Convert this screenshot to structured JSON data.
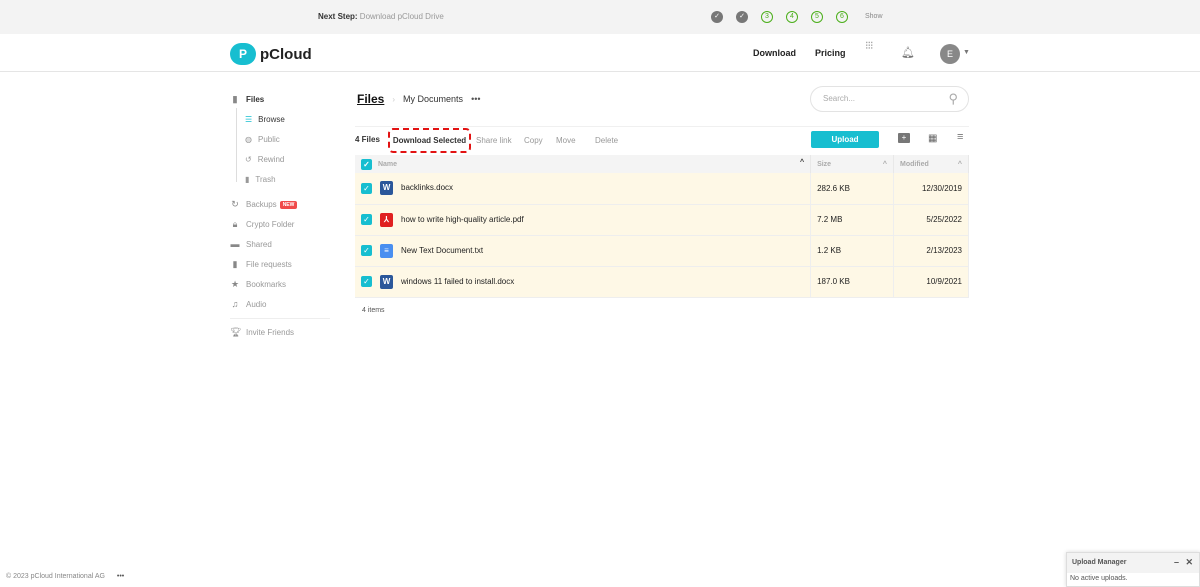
{
  "banner": {
    "next_step_label": "Next Step:",
    "next_step_text": "Download pCloud Drive",
    "steps": [
      "✓",
      "✓",
      "3",
      "4",
      "5",
      "6"
    ],
    "show": "Show"
  },
  "header": {
    "logo": "pCloud",
    "download": "Download",
    "pricing": "Pricing",
    "avatar": "E"
  },
  "sidebar": {
    "files": "Files",
    "sub": [
      "Browse",
      "Public",
      "Rewind",
      "Trash"
    ],
    "items": [
      "Backups",
      "Crypto Folder",
      "Shared",
      "File requests",
      "Bookmarks",
      "Audio"
    ],
    "new_badge": "NEW",
    "invite": "Invite Friends"
  },
  "breadcrumb": {
    "root": "Files",
    "current": "My Documents",
    "more": "•••"
  },
  "search": {
    "placeholder": "Search..."
  },
  "toolbar": {
    "count": "4 Files",
    "download_selected": "Download Selected",
    "share_link": "Share link",
    "copy": "Copy",
    "move": "Move",
    "delete": "Delete",
    "upload": "Upload"
  },
  "table": {
    "headers": [
      "Name",
      "Size",
      "Modified"
    ],
    "rows": [
      {
        "name": "backlinks.docx",
        "type": "word",
        "size": "282.6 KB",
        "modified": "12/30/2019"
      },
      {
        "name": "how to write high-quality article.pdf",
        "type": "pdf",
        "size": "7.2 MB",
        "modified": "5/25/2022"
      },
      {
        "name": "New Text Document.txt",
        "type": "text",
        "size": "1.2 KB",
        "modified": "2/13/2023"
      },
      {
        "name": "windows 11 failed to install.docx",
        "type": "word",
        "size": "187.0 KB",
        "modified": "10/9/2021"
      }
    ]
  },
  "item_count": "4 items",
  "footer": {
    "copyright": "© 2023 pCloud International AG",
    "more": "•••"
  },
  "upload_manager": {
    "title": "Upload Manager",
    "status": "No active uploads."
  },
  "colors": {
    "accent": "#17bed0",
    "highlight": "#e21212",
    "row": "#fef8e6"
  }
}
